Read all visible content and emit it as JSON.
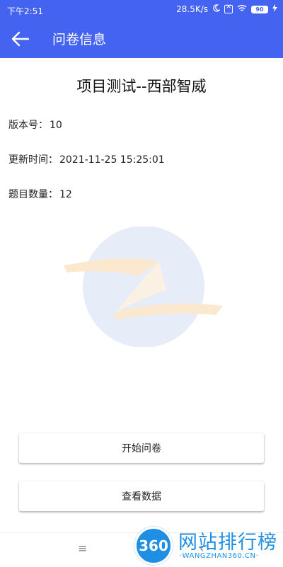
{
  "status_bar": {
    "time": "下午2:51",
    "network_speed": "28.5K/s",
    "battery": "90",
    "icons": [
      "moon-icon",
      "close-box-icon",
      "wifi-icon",
      "battery-icon",
      "charging-icon"
    ]
  },
  "app_bar": {
    "title": "问卷信息",
    "back_icon": "arrow-left-icon"
  },
  "survey": {
    "title": "项目测试--西部智威",
    "version_label": "版本号：",
    "version_value": "10",
    "updated_label": "更新时间：",
    "updated_value": "2021-11-25 15:25:01",
    "count_label": "题目数量：",
    "count_value": "12"
  },
  "actions": {
    "start_label": "开始问卷",
    "view_label": "查看数据"
  },
  "nav": {
    "menu_icon": "≡",
    "back_icon": "‹"
  },
  "brand": {
    "circle_text": "360",
    "name": "网站排行榜",
    "url": "·WANGZHAN360.CN·"
  },
  "colors": {
    "primary": "#4463f0",
    "brand_blue": "#1f8fe3"
  }
}
